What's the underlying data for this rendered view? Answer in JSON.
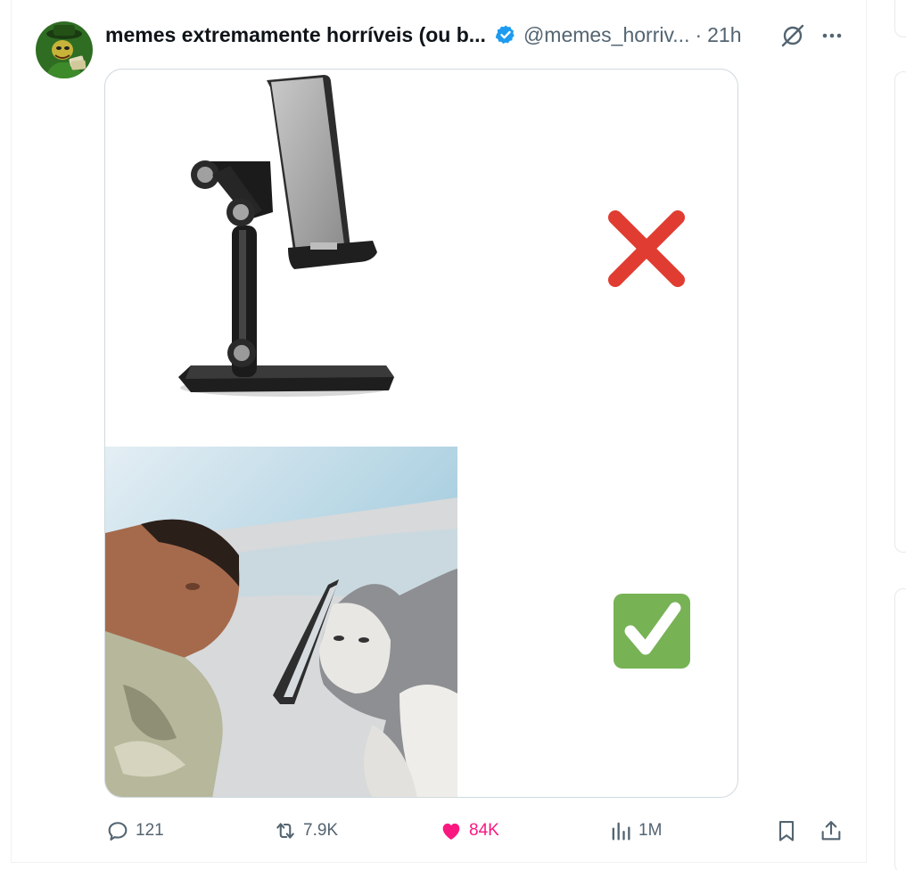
{
  "tweet": {
    "display_name": "memes extremamente horríveis (ou b...",
    "handle": "@memes_horriv...",
    "separator": "·",
    "time": "21h",
    "avatar_icon": "green-character-avatar",
    "verified_icon": "verified-badge-icon",
    "grok_icon": "grok-icon",
    "more_icon": "more-icon"
  },
  "media": {
    "top_panel": {
      "depicts": "phone-stand-icon",
      "mark": "red-x-icon"
    },
    "bottom_panel": {
      "depicts": "photo-man-and-cat-phone",
      "mark": "green-check-icon"
    }
  },
  "actions": {
    "replies": "121",
    "reposts": "7.9K",
    "likes": "84K",
    "views": "1M",
    "reply_icon": "reply-icon",
    "repost_icon": "repost-icon",
    "like_icon": "heart-icon",
    "views_icon": "bar-chart-icon",
    "bookmark_icon": "bookmark-icon",
    "share_icon": "share-icon"
  },
  "colors": {
    "like": "#f91880",
    "muted": "#536471",
    "verified": "#1d9bf0",
    "x_mark": "#e03c31",
    "check_mark": "#77b255"
  }
}
